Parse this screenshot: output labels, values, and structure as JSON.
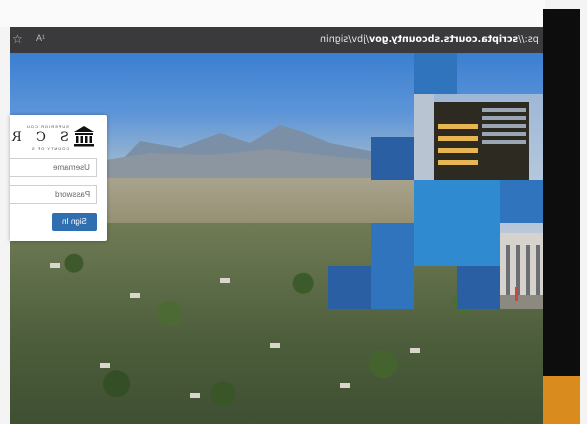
{
  "browser": {
    "url_prefix": "ps://",
    "url_host": "scripta.courts.sbcounty.gov",
    "url_path": "/jbv/signin",
    "read_aloud": "A¹",
    "favorite_icon": "star-icon"
  },
  "login": {
    "logo_top": "SUPERIOR COU",
    "logo_letters": "S C R",
    "logo_bottom": "COUNTY OF S",
    "username_placeholder": "Username",
    "password_placeholder": "Password",
    "signin_label": "Sign In"
  },
  "colors": {
    "accent": "#2f6fb0",
    "tile_dark": "#2b5fa3",
    "tile_light": "#2f8ad0",
    "chrome": "#3a3a3d",
    "side_orange": "#d98b1e"
  }
}
